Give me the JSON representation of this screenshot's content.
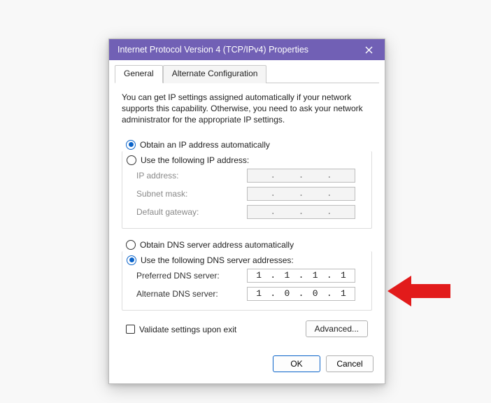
{
  "dialog": {
    "title": "Internet Protocol Version 4 (TCP/IPv4) Properties"
  },
  "tabs": {
    "general": "General",
    "alternate": "Alternate Configuration"
  },
  "description": "You can get IP settings assigned automatically if your network supports this capability. Otherwise, you need to ask your network administrator for the appropriate IP settings.",
  "ip_section": {
    "obtain_auto": "Obtain an IP address automatically",
    "use_following": "Use the following IP address:",
    "ip_address_label": "IP address:",
    "subnet_label": "Subnet mask:",
    "gateway_label": "Default gateway:"
  },
  "dns_section": {
    "obtain_auto": "Obtain DNS server address automatically",
    "use_following": "Use the following DNS server addresses:",
    "preferred_label": "Preferred DNS server:",
    "alternate_label": "Alternate DNS server:",
    "preferred_value": {
      "o1": "1",
      "o2": "1",
      "o3": "1",
      "o4": "1"
    },
    "alternate_value": {
      "o1": "1",
      "o2": "0",
      "o3": "0",
      "o4": "1"
    }
  },
  "validate_label": "Validate settings upon exit",
  "buttons": {
    "advanced": "Advanced...",
    "ok": "OK",
    "cancel": "Cancel"
  },
  "arrow_color": "#e21b1b"
}
